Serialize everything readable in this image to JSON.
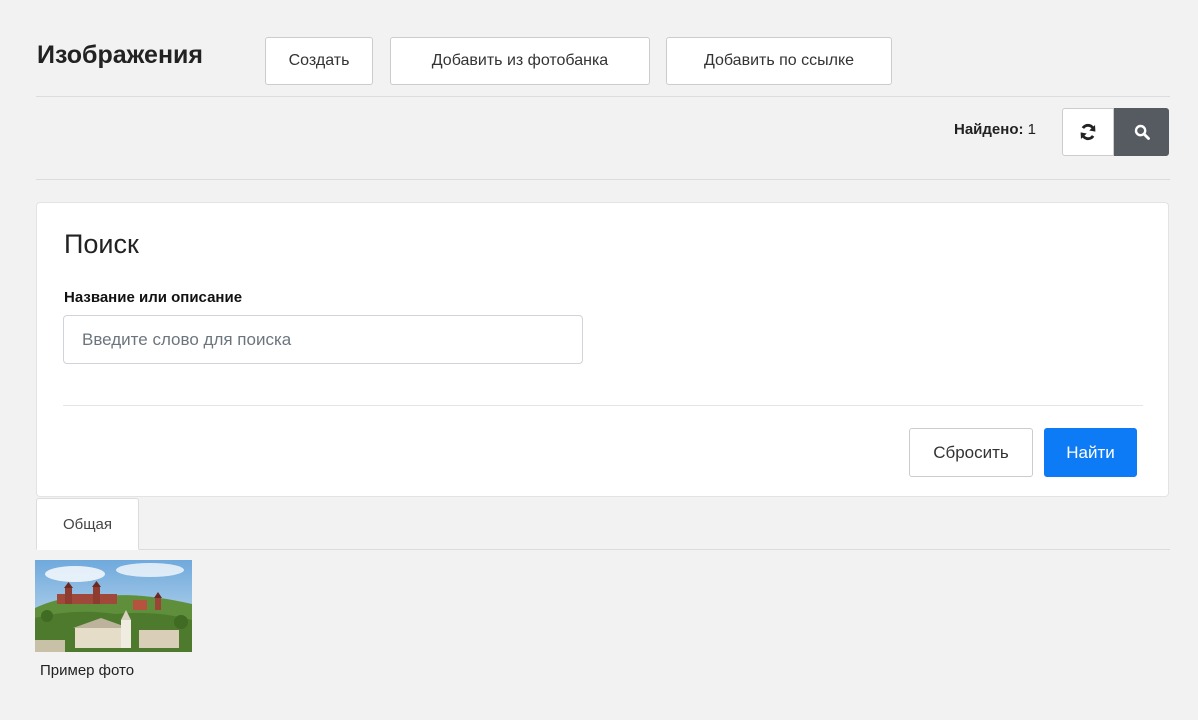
{
  "header": {
    "title": "Изображения",
    "buttons": {
      "create": "Создать",
      "from_photobank": "Добавить из фотобанка",
      "by_link": "Добавить по ссылке"
    }
  },
  "toolbar": {
    "found_label": "Найдено:",
    "found_count": "1",
    "refresh_icon": "refresh-icon",
    "search_icon": "search-icon"
  },
  "search": {
    "title": "Поиск",
    "field_label": "Название или описание",
    "placeholder": "Введите слово для поиска",
    "value": "",
    "reset_label": "Сбросить",
    "submit_label": "Найти"
  },
  "tabs": [
    {
      "label": "Общая",
      "active": true
    }
  ],
  "gallery": {
    "items": [
      {
        "caption": "Пример фото"
      }
    ]
  },
  "colors": {
    "background": "#f2f2f2",
    "primary": "#0d7bf5",
    "search_button": "#555b61"
  }
}
